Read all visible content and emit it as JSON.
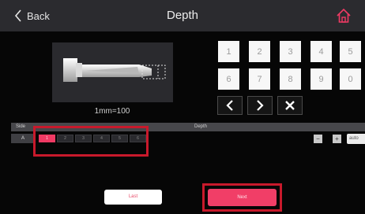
{
  "header": {
    "back_label": "Back",
    "title": "Depth"
  },
  "key_image": {
    "scale_label": "1mm=100"
  },
  "keypad": {
    "digits": [
      "1",
      "2",
      "3",
      "4",
      "5",
      "6",
      "7",
      "8",
      "9",
      "0"
    ]
  },
  "table": {
    "headers": {
      "side": "Side",
      "depth": "Depth"
    },
    "row_label": "A",
    "cells": [
      "1",
      "2",
      "3",
      "4",
      "5",
      "6"
    ],
    "selected_index": 0,
    "auto_label": "auto"
  },
  "buttons": {
    "last": "Last",
    "next": "Next"
  },
  "colors": {
    "accent": "#f13e67",
    "highlight_box": "#c8192b",
    "topbar": "#2b2b2f"
  }
}
